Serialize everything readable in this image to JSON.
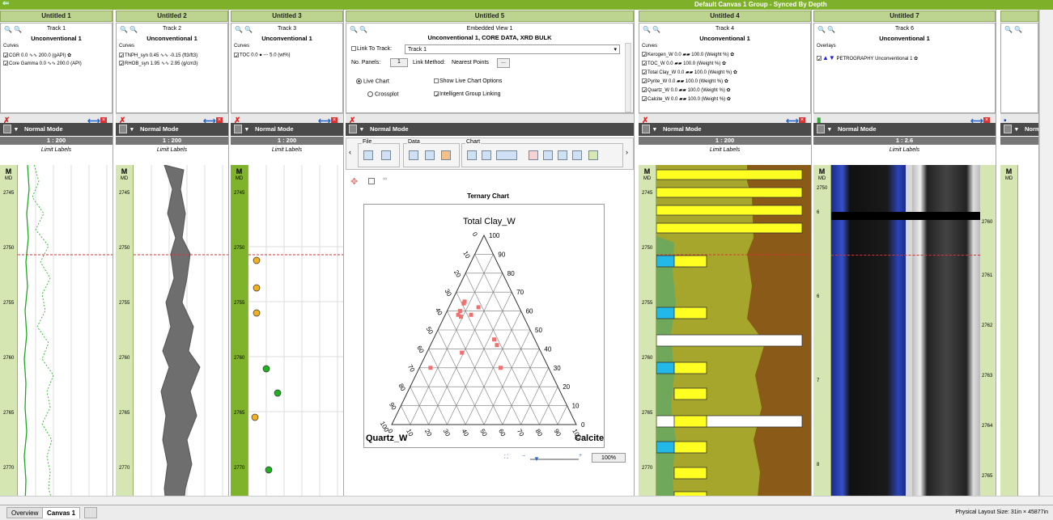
{
  "window": {
    "title": "Default Canvas 1 Group  -  Synced By Depth"
  },
  "tracks": [
    {
      "header": "Untitled 1",
      "track": "Track 1",
      "well": "Unconventional 1",
      "curves_label": "Curves",
      "curves": [
        "CGR 0.0 ∿∿ 200.0 (gAPI) ✿",
        "Core Gamma 0.0 ∿∿ 200.0 (API)"
      ],
      "mode": "Normal Mode",
      "scale": "1 : 200",
      "limit": "Limit Labels",
      "depth_head": "M",
      "depth_unit": "MD",
      "depths": [
        "2745",
        "2750",
        "2755",
        "2760",
        "2765",
        "2770"
      ]
    },
    {
      "header": "Untitled 2",
      "track": "Track 2",
      "well": "Unconventional 1",
      "curves_label": "Curves",
      "curves": [
        "TNPH_syn 0.45 ∿∿ -0.15 (ft3/ft3)",
        "RHOB_syn 1.95 ∿∿ 2.95 (g/cm3)"
      ],
      "mode": "Normal Mode",
      "scale": "1 : 200",
      "limit": "Limit Labels",
      "depth_head": "M",
      "depth_unit": "MD",
      "depths": [
        "2745",
        "2750",
        "2755",
        "2760",
        "2765",
        "2770"
      ]
    },
    {
      "header": "Untitled 3",
      "track": "Track 3",
      "well": "Unconventional 1",
      "curves_label": "Curves",
      "curves": [
        "TOC 0.0 ● --- 5.0 (wt%)"
      ],
      "mode": "Normal Mode",
      "scale": "1 : 200",
      "limit": "Limit Labels",
      "depth_head": "M",
      "depth_unit": "MD",
      "depths": [
        "2745",
        "2750",
        "2755",
        "2760",
        "2765",
        "2770"
      ]
    },
    {
      "header": "Untitled 4",
      "track": "Track 4",
      "well": "Unconventional 1",
      "curves_label": "Curves",
      "curves": [
        "Kerogen_W 0.0 ▰▰ 100.0 (Weight %) ✿",
        "TOC_W 0.0 ▰▰ 100.0 (Weight %) ✿",
        "Total Clay_W 0.0 ▰▰ 100.0 (Weight %) ✿",
        "Pyrite_W 0.0 ▰▰ 100.0 (Weight %) ✿",
        "Quartz_W 0.0 ▰▰ 100.0 (Weight %) ✿",
        "Calcite_W 0.0 ▰▰ 100.0 (Weight %) ✿"
      ],
      "mode": "Normal Mode",
      "scale": "1 : 200",
      "limit": "Limit Labels",
      "depth_head": "M",
      "depth_unit": "MD",
      "depths": [
        "2745",
        "2750",
        "2755",
        "2760",
        "2765",
        "2770"
      ]
    },
    {
      "header": "Untitled 7",
      "track": "Track 6",
      "well": "Unconventional 1",
      "curves_label": "Overlays",
      "curves": [
        "PETROGRAPHY Unconventional 1 ✿"
      ],
      "mode": "Normal Mode",
      "scale": "1 : 2.6",
      "limit": "Limit Labels",
      "depth_head": "M",
      "depth_unit": "MD",
      "depths": [
        "2750",
        "6",
        "6",
        "7",
        "7",
        "8"
      ],
      "right_depths": [
        "2760",
        "2761",
        "2762",
        "2763",
        "2764",
        "2765"
      ]
    },
    {
      "header": "",
      "track": "",
      "well": "",
      "curves_label": "",
      "mode": "Normal Mode",
      "depth_head": "M",
      "depth_unit": "MD"
    }
  ],
  "embedded": {
    "header": "Untitled 5",
    "title": "Embedded View 1",
    "subtitle": "Unconventional 1, CORE DATA, XRD BULK",
    "link_label": "Link To Track:",
    "link_value": "Track 1",
    "panels_label": "No. Panels:",
    "panels_value": "1",
    "link_method_label": "Link Method:",
    "link_method_value": "Nearest Points",
    "ellipsis": "...",
    "live_chart": "Live Chart",
    "crossplot": "Crossplot",
    "show_live": "Show Live Chart Options",
    "intelligent": "Intelligent Group Linking",
    "mode": "Normal Mode",
    "ribbon": {
      "file": "File",
      "data": "Data",
      "chart": "Chart"
    },
    "chart_title": "Ternary Chart",
    "zoom": "100%"
  },
  "chart_data": {
    "type": "scatter",
    "subtype": "ternary",
    "title": "Ternary Chart",
    "axes": {
      "top": "Total Clay_W",
      "left": "Quartz_W",
      "right": "Calcite_W"
    },
    "ticks": [
      0,
      10,
      20,
      30,
      40,
      50,
      60,
      70,
      80,
      90,
      100
    ],
    "points": [
      {
        "clay": 65,
        "quartz": 28,
        "calcite": 7
      },
      {
        "clay": 64,
        "quartz": 29,
        "calcite": 7
      },
      {
        "clay": 60,
        "quartz": 33,
        "calcite": 7
      },
      {
        "clay": 58,
        "quartz": 35,
        "calcite": 7
      },
      {
        "clay": 57,
        "quartz": 34,
        "calcite": 9
      },
      {
        "clay": 58,
        "quartz": 28,
        "calcite": 14
      },
      {
        "clay": 62,
        "quartz": 22,
        "calcite": 16
      },
      {
        "clay": 45,
        "quartz": 22,
        "calcite": 33
      },
      {
        "clay": 42,
        "quartz": 22,
        "calcite": 36
      },
      {
        "clay": 38,
        "quartz": 43,
        "calcite": 19
      },
      {
        "clay": 30,
        "quartz": 64,
        "calcite": 6
      },
      {
        "clay": 30,
        "quartz": 26,
        "calcite": 44
      }
    ],
    "grid": true
  },
  "tabs": [
    "Overview",
    "Canvas 1"
  ],
  "status": "Physical Layout Size: 31in × 45877in",
  "colors": {
    "green": "#7fb02a",
    "yellow": "#ffff22",
    "olive": "#a8a62a",
    "brown": "#8a4a12",
    "cyan": "#22b8e8",
    "teal": "#4cb39a"
  }
}
